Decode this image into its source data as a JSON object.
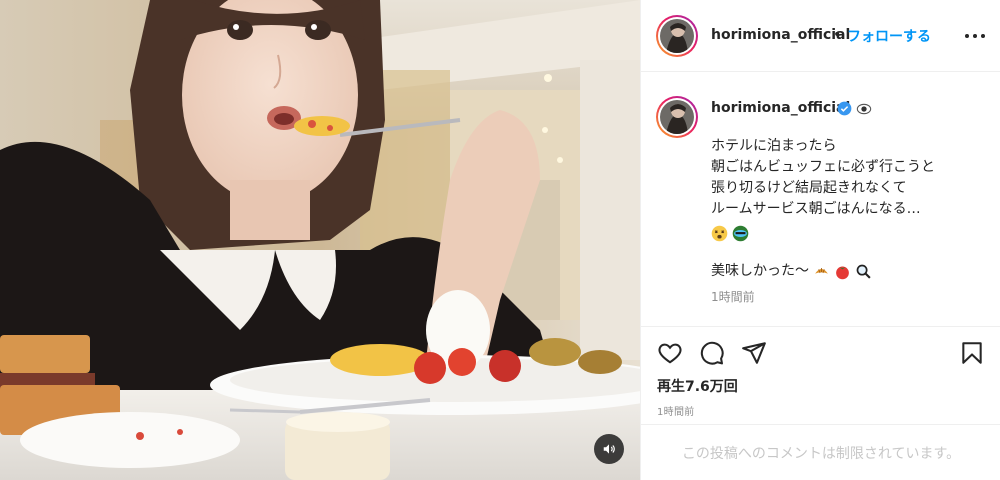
{
  "header": {
    "username": "horimiona_official",
    "separator": "•",
    "follow_label": "フォローする",
    "more_icon": "more-horizontal-icon"
  },
  "caption": {
    "username": "horimiona_official",
    "verified_icon": "verified-badge-icon",
    "trailing_emoji": "eye-emoji",
    "lines": [
      "ホテルに泊まったら",
      "朝ごはんビュッフェに必ず行こうと",
      "張り切るけど結局起きれなくて",
      "ルームサービス朝ごはんになる…"
    ],
    "emoji_row_1": [
      "dizzy-face-emoji",
      "sleepy-bus-emoji"
    ],
    "closing_line": "美味しかった〜",
    "emoji_row_2": [
      "croissant-emoji",
      "tomato-emoji",
      "magnifier-emoji"
    ],
    "time": "1時間前"
  },
  "actions": {
    "like_icon": "heart-icon",
    "comment_icon": "comment-icon",
    "share_icon": "share-icon",
    "save_icon": "bookmark-icon"
  },
  "stats": {
    "views": "再生7.6万回",
    "time": "1時間前"
  },
  "comments": {
    "restricted_text": "この投稿へのコメントは制限されています。"
  },
  "media": {
    "mute_icon": "speaker-icon"
  },
  "colors": {
    "accent": "#0095f6",
    "text": "#262626",
    "muted": "#8e8e8e",
    "border": "#efefef"
  }
}
